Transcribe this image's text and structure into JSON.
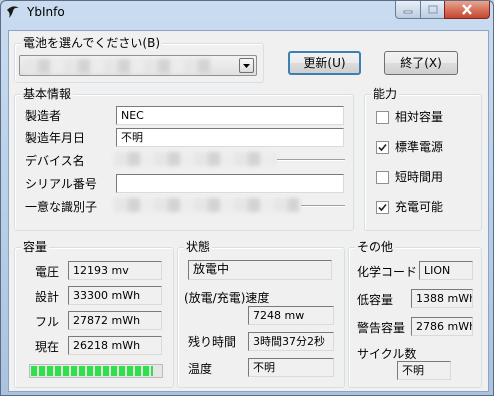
{
  "window": {
    "title": "YbInfo"
  },
  "battery_select": {
    "label": "電池を選んでください(B)"
  },
  "buttons": {
    "refresh": "更新(U)",
    "exit": "終了(X)"
  },
  "basic_info": {
    "title": "基本情報",
    "maker_label": "製造者",
    "maker_value": "NEC",
    "date_label": "製造年月日",
    "date_value": "不明",
    "device_label": "デバイス名",
    "serial_label": "シリアル番号",
    "uid_label": "一意な識別子"
  },
  "capability": {
    "title": "能力",
    "items": [
      {
        "label": "相対容量",
        "checked": false
      },
      {
        "label": "標準電源",
        "checked": true
      },
      {
        "label": "短時間用",
        "checked": false
      },
      {
        "label": "充電可能",
        "checked": true
      }
    ]
  },
  "capacity": {
    "title": "容量",
    "voltage_label": "電圧",
    "voltage_value": "12193 mv",
    "design_label": "設計",
    "design_value": "33300 mWh",
    "full_label": "フル",
    "full_value": "27872 mWh",
    "current_label": "現在",
    "current_value": "26218 mWh",
    "level_fraction": 0.94
  },
  "status": {
    "title": "状態",
    "state_value": "放電中",
    "rate_label": "(放電/充電)速度",
    "rate_value": "7248 mw",
    "remaining_label": "残り時間",
    "remaining_value": "3時間37分2秒",
    "temp_label": "温度",
    "temp_value": "不明"
  },
  "other": {
    "title": "その他",
    "chem_label": "化学コード",
    "chem_value": "LION",
    "low_label": "低容量",
    "low_value": "1388 mWh",
    "warn_label": "警告容量",
    "warn_value": "2786 mWh",
    "cycle_label": "サイクル数",
    "cycle_value": "不明"
  },
  "colors": {
    "accent_default_button": "#3c7fb1",
    "progress": "#2ee04a",
    "close_button": "#c5462e"
  }
}
